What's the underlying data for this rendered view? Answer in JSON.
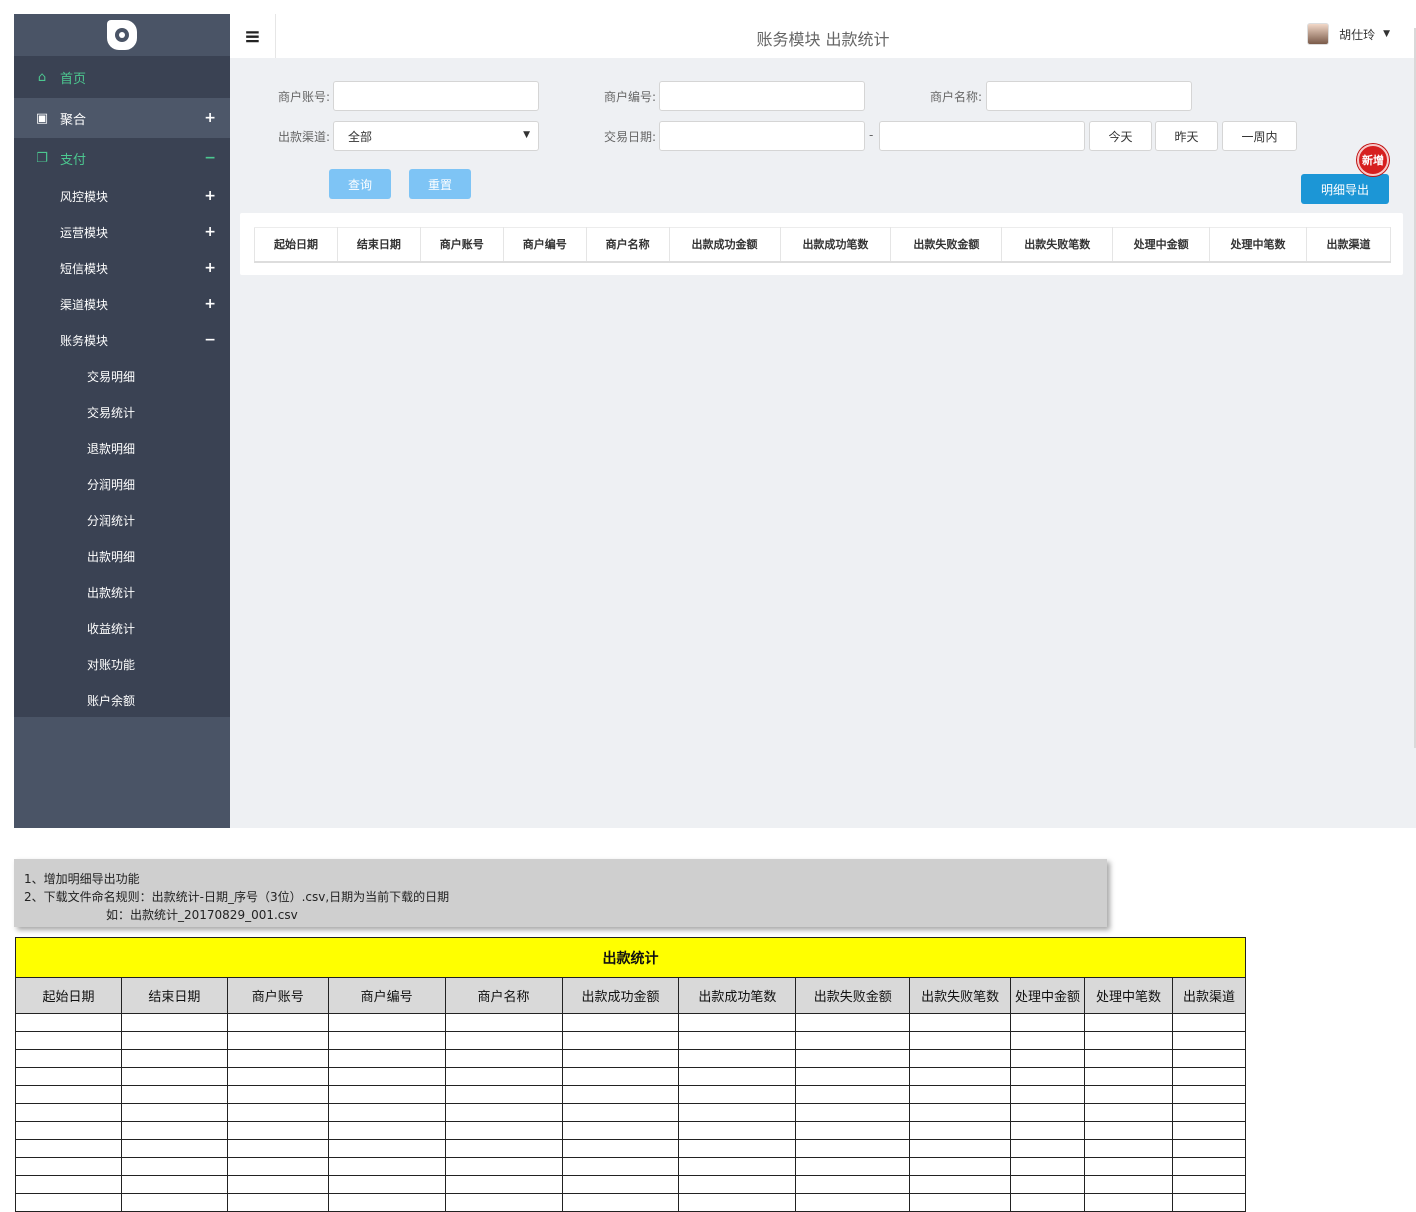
{
  "sidebar": {
    "home": "首页",
    "juhe": "聚合",
    "pay": "支付",
    "submodules": [
      {
        "label": "风控模块",
        "toggle": "+"
      },
      {
        "label": "运营模块",
        "toggle": "+"
      },
      {
        "label": "短信模块",
        "toggle": "+"
      },
      {
        "label": "渠道模块",
        "toggle": "+"
      },
      {
        "label": "账务模块",
        "toggle": "−"
      }
    ],
    "leaves": [
      "交易明细",
      "交易统计",
      "退款明细",
      "分润明细",
      "分润统计",
      "出款明细",
      "出款统计",
      "收益统计",
      "对账功能",
      "账户余额"
    ],
    "plus": "+",
    "minus": "−"
  },
  "header": {
    "menu_icon": "≡",
    "title": "账务模块 出款统计",
    "user_name": "胡仕玲",
    "caret": "▼"
  },
  "filters": {
    "merchant_account_label": "商户账号:",
    "merchant_id_label": "商户编号:",
    "merchant_name_label": "商户名称:",
    "channel_label": "出款渠道:",
    "channel_value": "全部",
    "trade_date_label": "交易日期:",
    "date_sep": "-",
    "today": "今天",
    "yesterday": "昨天",
    "week": "一周内",
    "query": "查询",
    "reset": "重置",
    "export": "明细导出",
    "new_badge": "新增"
  },
  "table_columns": [
    "起始日期",
    "结束日期",
    "商户账号",
    "商户编号",
    "商户名称",
    "出款成功金额",
    "出款成功笔数",
    "出款失败金额",
    "出款失败笔数",
    "处理中金额",
    "处理中笔数",
    "出款渠道"
  ],
  "notes": {
    "line1": "1、增加明细导出功能",
    "line2": "2、下载文件命名规则：出款统计-日期_序号（3位）.csv,日期为当前下载的日期",
    "line3": "如：出款统计_20170829_001.csv"
  },
  "sheet": {
    "title": "出款统计",
    "columns": [
      "起始日期",
      "结束日期",
      "商户账号",
      "商户编号",
      "商户名称",
      "出款成功金额",
      "出款成功笔数",
      "出款失败金额",
      "出款失败笔数",
      "处理中金额",
      "处理中笔数",
      "出款渠道"
    ],
    "empty_rows": 11
  }
}
